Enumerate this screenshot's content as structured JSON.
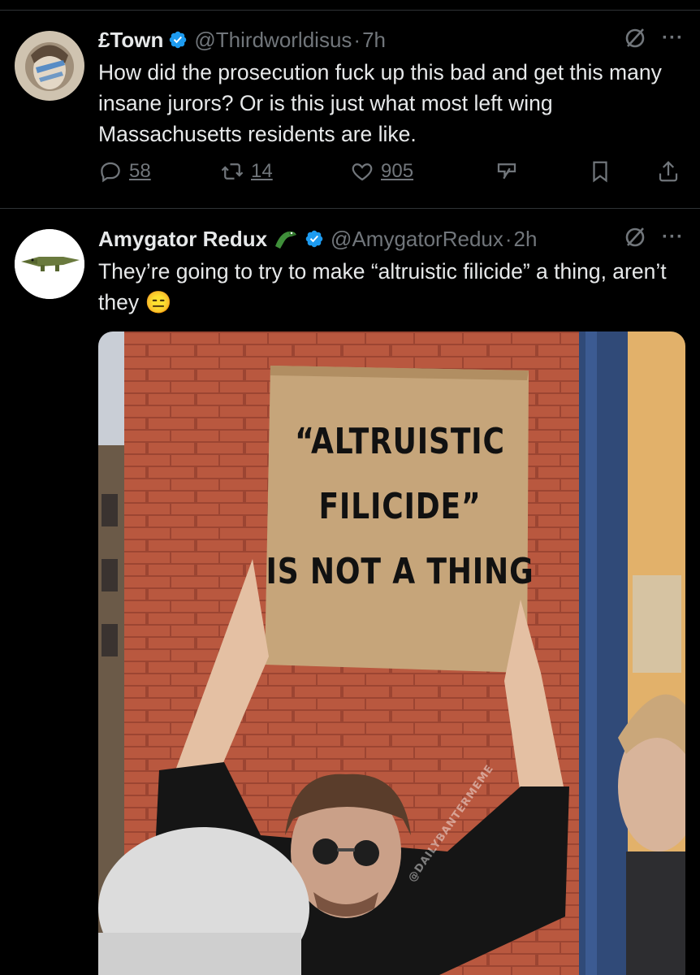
{
  "tweets": [
    {
      "name": "£Town",
      "handle": "@Thirdworldisus",
      "separator": "·",
      "time": "7h",
      "more": "···",
      "text": "How did the prosecution fuck up this bad and get this many insane jurors? Or is this just what most left wing Massachusetts residents are like.",
      "replies": "58",
      "reposts": "14",
      "likes": "905",
      "icons": [
        "verified-badge-icon",
        "grok-icon",
        "more-icon",
        "reply-icon",
        "repost-icon",
        "like-icon",
        "grok-analyze-icon",
        "bookmark-icon",
        "share-icon"
      ]
    },
    {
      "name": "Amygator Redux",
      "handle": "@AmygatorRedux",
      "separator": "·",
      "time": "2h",
      "more": "···",
      "text": "They’re going to try to make “altruistic filicide” a thing, aren’t they",
      "emoji": "😑",
      "name_emoji_icon": "alligator-icon",
      "media": {
        "sign_lines": [
          "“ALTRUISTIC",
          "FILICIDE”",
          "IS NOT A THING"
        ],
        "watermark": "@DAILYBANTERMEME"
      }
    }
  ],
  "colors": {
    "background": "#000000",
    "text": "#e7e9ea",
    "muted": "#71767b",
    "verified": "#1d9bf0",
    "divider": "#2f3336",
    "brick": "#b5533c",
    "cardboard": "#c9ab80"
  }
}
